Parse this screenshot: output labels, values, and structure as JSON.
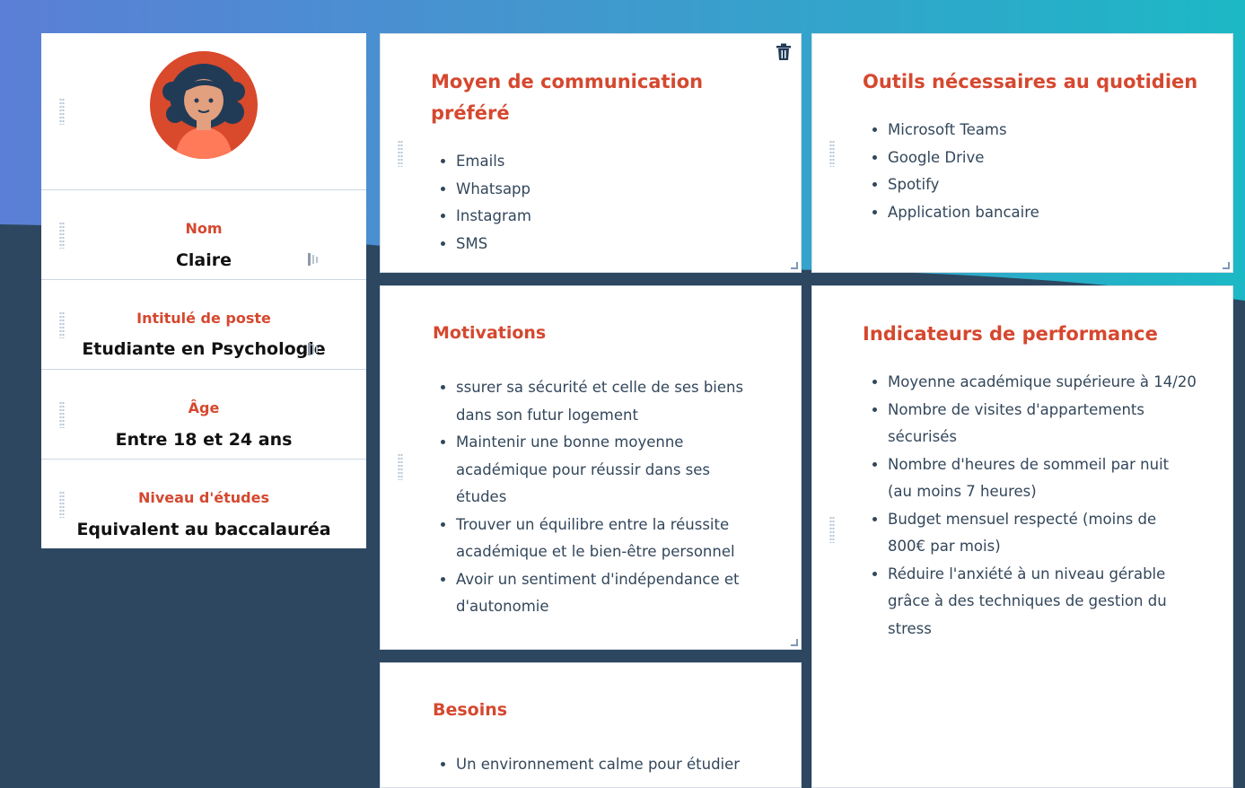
{
  "profile": {
    "avatar_alt": "avatar",
    "fields": [
      {
        "label": "Nom",
        "value": "Claire"
      },
      {
        "label": "Intitulé de poste",
        "value": "Etudiante en Psychologie"
      },
      {
        "label": "Âge",
        "value": "Entre 18 et 24 ans"
      },
      {
        "label": "Niveau d'études",
        "value": "Equivalent au baccalauréa"
      }
    ]
  },
  "cards": {
    "communication": {
      "title": "Moyen de communication préféré",
      "items": [
        "Emails",
        "Whatsapp",
        "Instagram",
        "SMS"
      ]
    },
    "tools": {
      "title": "Outils nécessaires au quotidien",
      "items": [
        "Microsoft Teams",
        "Google Drive",
        "Spotify",
        "Application bancaire"
      ]
    },
    "motivations": {
      "title": "Motivations",
      "items": [
        "ssurer sa sécurité et celle de ses biens dans son futur logement",
        "Maintenir une bonne moyenne académique pour réussir dans ses études",
        "Trouver un équilibre entre la réussite académique et le bien-être personnel",
        "Avoir un sentiment d'indépendance et d'autonomie"
      ]
    },
    "kpis": {
      "title": "Indicateurs de performance",
      "items": [
        "Moyenne académique supérieure à 14/20",
        "Nombre de visites d'appartements sécurisés",
        "Nombre d'heures de sommeil par nuit (au moins 7 heures)",
        "Budget mensuel respecté (moins de 800€ par mois)",
        "Réduire l'anxiété à un niveau gérable grâce à des techniques de gestion du stress"
      ]
    },
    "needs": {
      "title": "Besoins",
      "items": [
        "Un environnement calme pour étudier"
      ]
    }
  },
  "colors": {
    "accent": "#d5482f",
    "text": "#33475b",
    "background_dark": "#2d4760"
  }
}
